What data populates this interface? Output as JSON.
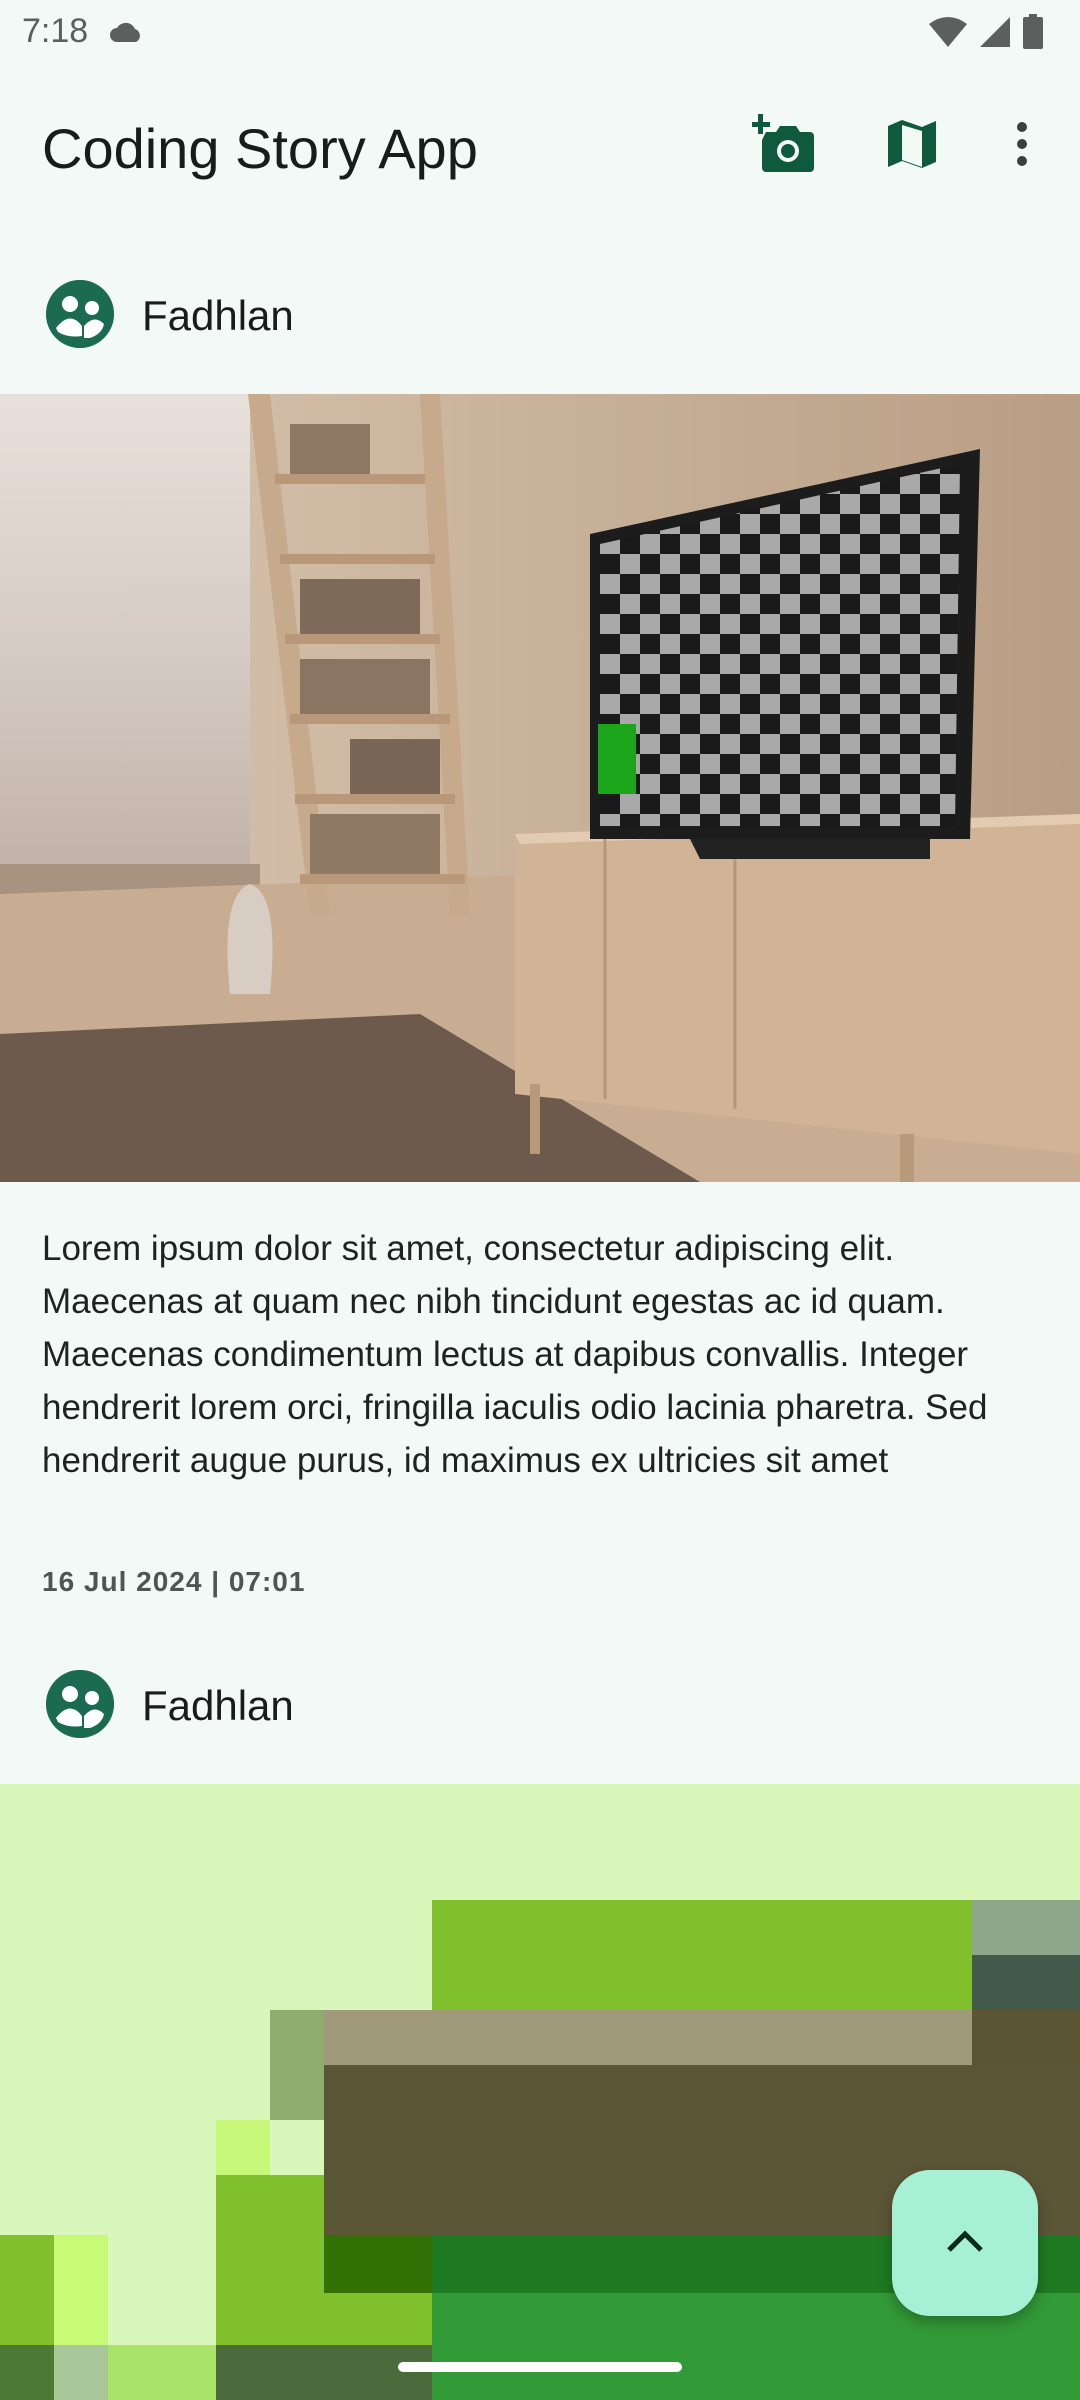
{
  "status_bar": {
    "time": "7:18",
    "icons": [
      "cloud-icon",
      "wifi-icon",
      "signal-icon",
      "battery-icon"
    ]
  },
  "app_bar": {
    "title": "Coding Story App",
    "actions": [
      "add-photo-icon",
      "map-icon",
      "more-vert-icon"
    ]
  },
  "stories": [
    {
      "author": "Fadhlan",
      "description": "Lorem ipsum dolor sit amet, consectetur adipiscing elit. Maecenas at quam nec nibh tincidunt egestas ac id quam. Maecenas condimentum lectus at dapibus convallis. Integer hendrerit lorem orci, fringilla iaculis odio lacinia pharetra. Sed hendrerit augue purus, id maximus ex ultricies sit amet",
      "date": "16 Jul 2024 | 07:01"
    },
    {
      "author": "Fadhlan"
    }
  ],
  "fab": {
    "icon": "chevron-up-icon"
  },
  "colors": {
    "background": "#f3f9f6",
    "primary": "#1b6b50",
    "fab": "#a6f0d6"
  }
}
